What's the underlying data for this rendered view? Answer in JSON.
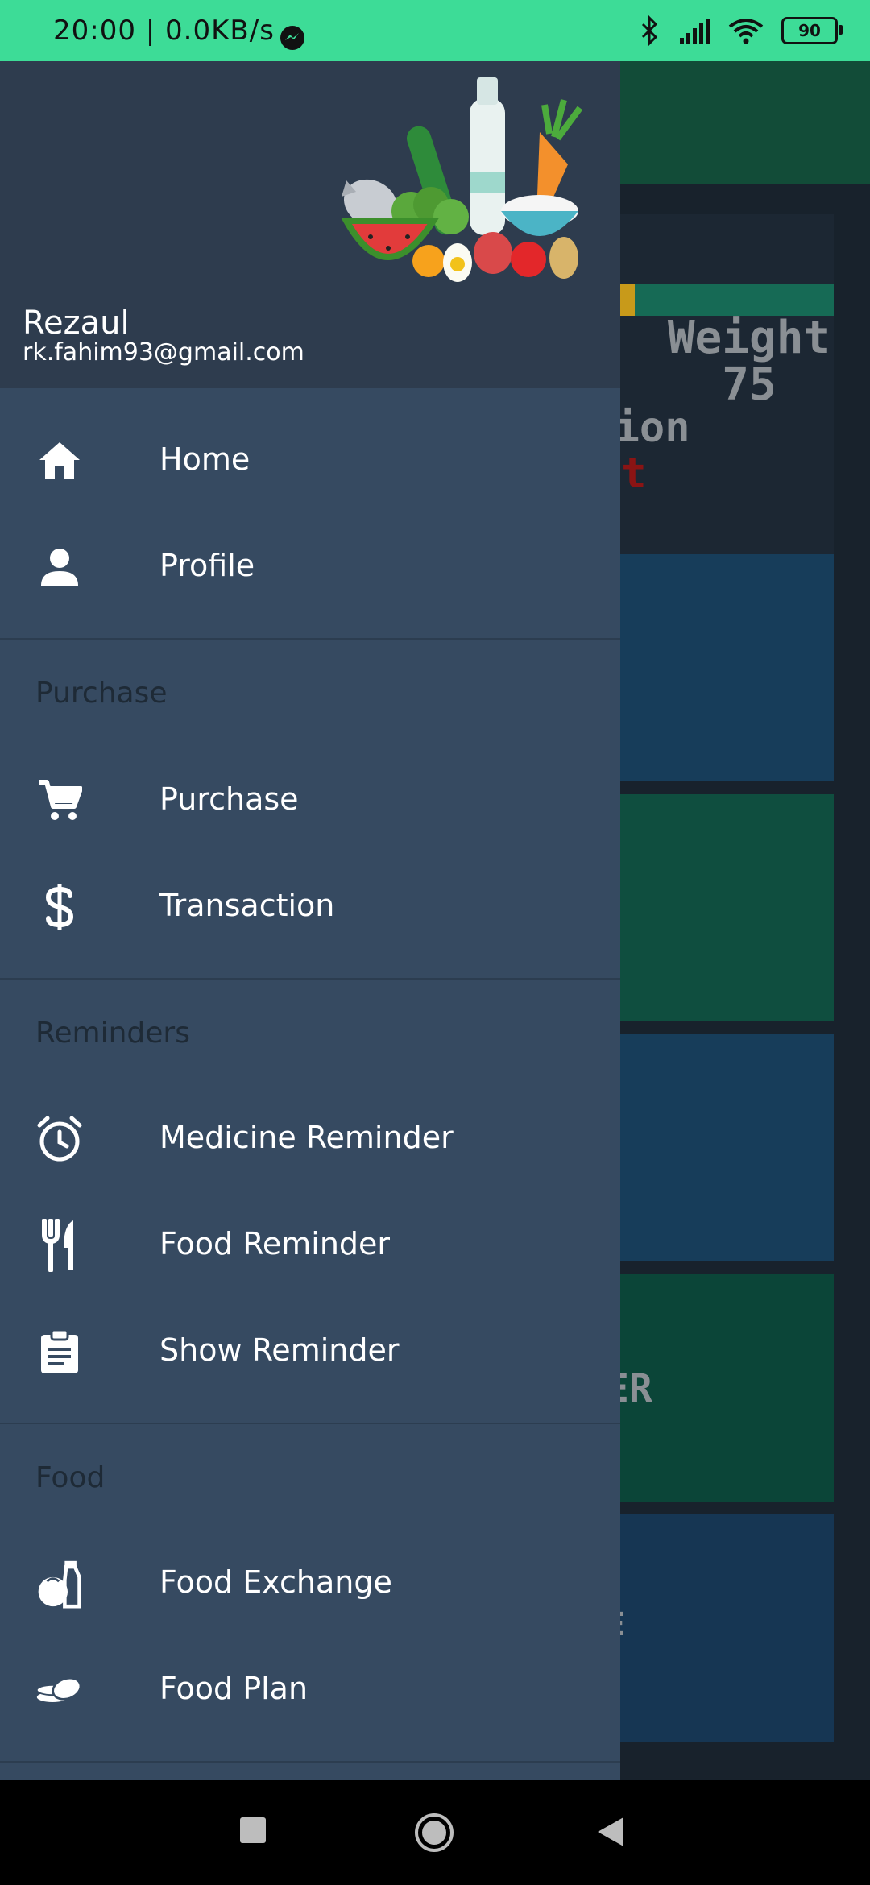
{
  "status_bar": {
    "time": "20:00 | 0.0KB/s",
    "battery": "90"
  },
  "background": {
    "weight_label": "Weight",
    "weight_value": "75",
    "condition_partial": "ition",
    "condition_value_partial": "ht",
    "tile_label_partial": "ER",
    "tile_label_partial_2": "E"
  },
  "drawer": {
    "user": {
      "name": "Rezaul",
      "email": "rk.fahim93@gmail.com"
    },
    "items": {
      "home": "Home",
      "profile": "Profile",
      "purchase": "Purchase",
      "transaction": "Transaction",
      "medicine_reminder": "Medicine Reminder",
      "food_reminder": "Food Reminder",
      "show_reminder": "Show Reminder",
      "food_exchange": "Food Exchange",
      "food_plan": "Food Plan"
    },
    "sections": {
      "purchase": "Purchase",
      "reminders": "Reminders",
      "food": "Food"
    }
  },
  "icons": [
    "home-icon",
    "person-icon",
    "cart-icon",
    "dollar-icon",
    "alarm-icon",
    "fork-knife-icon",
    "clipboard-icon",
    "food-exchange-icon",
    "food-plan-icon"
  ]
}
